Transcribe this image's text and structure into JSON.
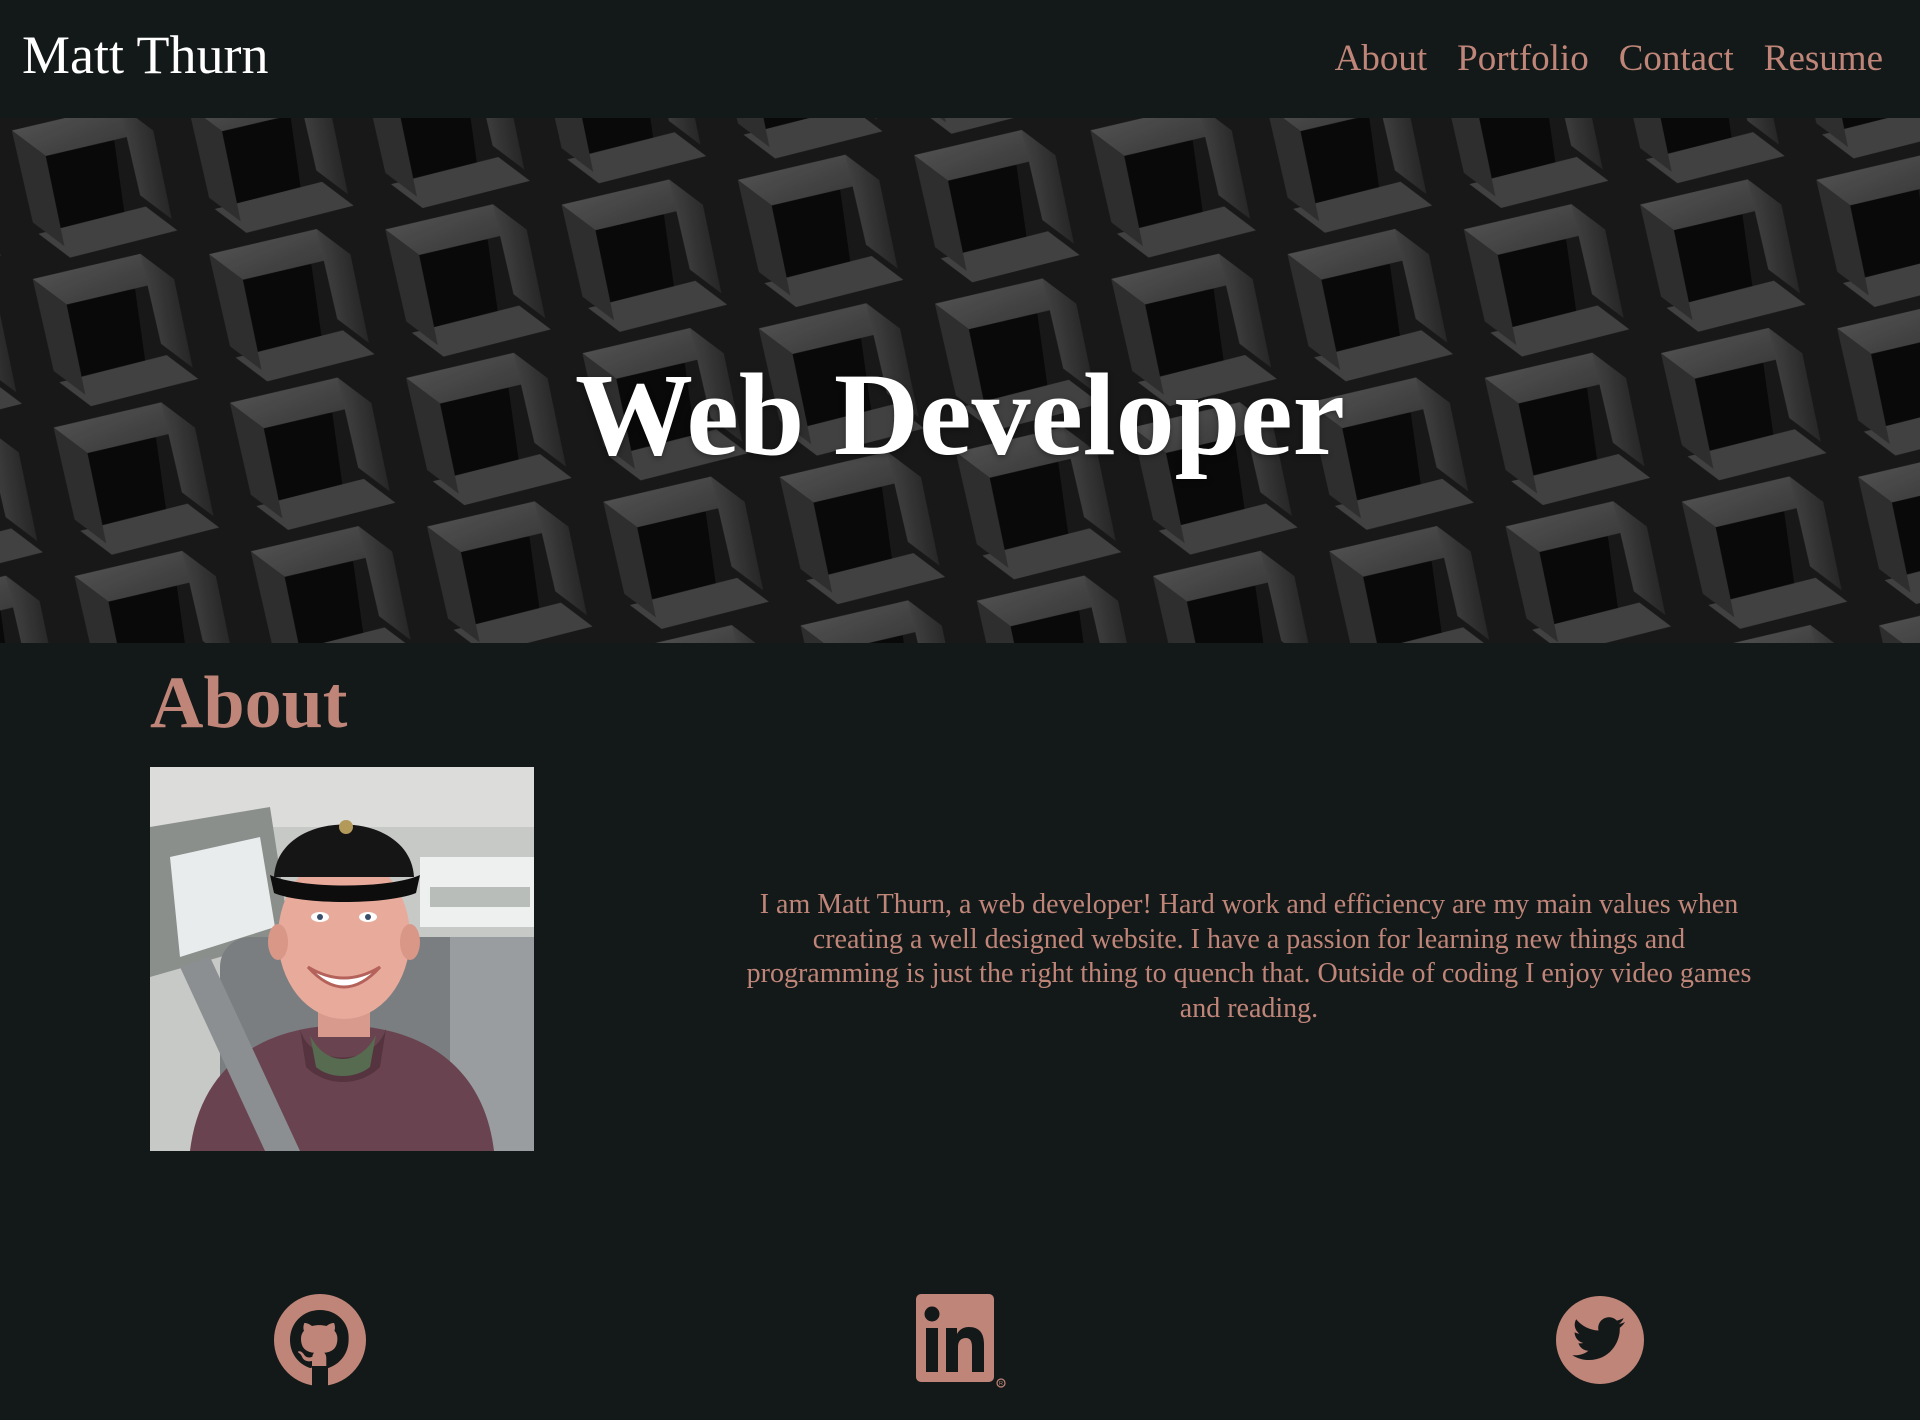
{
  "header": {
    "brand": "Matt Thurn",
    "nav": [
      "About",
      "Portfolio",
      "Contact",
      "Resume"
    ]
  },
  "hero": {
    "title": "Web Developer"
  },
  "about": {
    "heading": "About",
    "bio": "I am Matt Thurn, a web developer! Hard work and efficiency are my main values when creating a well designed website. I have a passion for learning new things and programming is just the right thing to quench that. Outside of coding I enjoy video games and reading.",
    "photo": "profile-photo"
  },
  "social": [
    "github-icon",
    "linkedin-icon",
    "twitter-icon"
  ],
  "colors": {
    "background": "#131918",
    "accent": "#c08579",
    "text_light": "#ffffff"
  }
}
